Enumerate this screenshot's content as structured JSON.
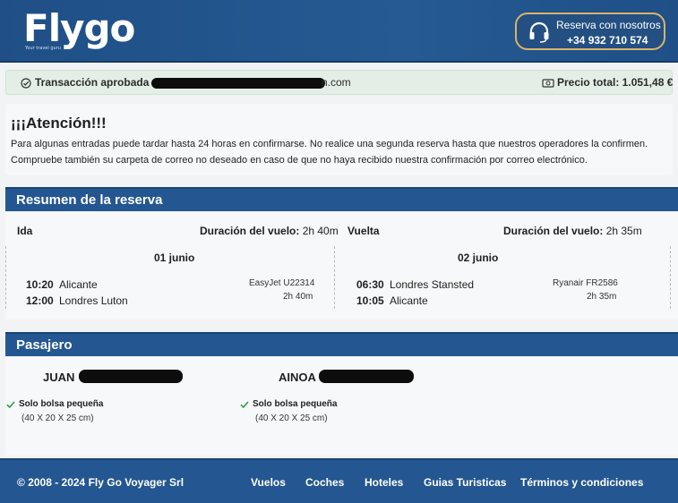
{
  "header": {
    "logo": "Flygo",
    "logo_tagline": "Your travel guru",
    "contact_title": "Reserva con nosotros",
    "contact_phone": "+34 932 710 574"
  },
  "transaction": {
    "label": "Transacción aprobada :",
    "email_suffix": "n.com",
    "price_label": "Precio total: 1.051,48 €"
  },
  "attention": {
    "title": "¡¡¡Atención!!!",
    "line1": "Para algunas entradas puede tardar hasta 24 horas en confirmarse. No realice una segunda reserva hasta que nuestros operadores la confirmen.",
    "line2": "Compruebe también su carpeta de correo no deseado en caso de que no haya recibido nuestra confirmación por correo electrónico."
  },
  "summary": {
    "title": "Resumen de la reserva",
    "outbound": {
      "label": "Ida",
      "duration_label": "Duración del vuelo:",
      "duration": "2h 40m",
      "date": "01 junio",
      "dep_time": "10:20",
      "dep_city": "Alicante",
      "arr_time": "12:00",
      "arr_city": "Londres Luton",
      "flight": "EasyJet U22314",
      "flight_duration": "2h 40m"
    },
    "return": {
      "label": "Vuelta",
      "duration_label": "Duración del vuelo:",
      "duration": "2h 35m",
      "date": "02 junio",
      "dep_time": "06:30",
      "dep_city": "Londres Stansted",
      "arr_time": "10:05",
      "arr_city": "Alicante",
      "flight": "Ryanair FR2586",
      "flight_duration": "2h 35m"
    }
  },
  "passengers": {
    "title": "Pasajero",
    "list": [
      {
        "name": "JUAN",
        "bag": "Solo bolsa pequeña",
        "dims": "(40 X 20 X 25 cm)"
      },
      {
        "name": "AINOA",
        "bag": "Solo bolsa pequeña",
        "dims": "(40 X 20 X 25 cm)"
      }
    ]
  },
  "footer": {
    "copyright": "© 2008 - 2024 Fly Go Voyager Srl",
    "links": [
      "Vuelos",
      "Coches",
      "Hoteles",
      "Guias Turisticas",
      "Términos y condiciones"
    ]
  },
  "colors": {
    "brand_blue": "#245791",
    "accent_gold": "#d8b46a",
    "success_bg": "#e3efe6"
  }
}
